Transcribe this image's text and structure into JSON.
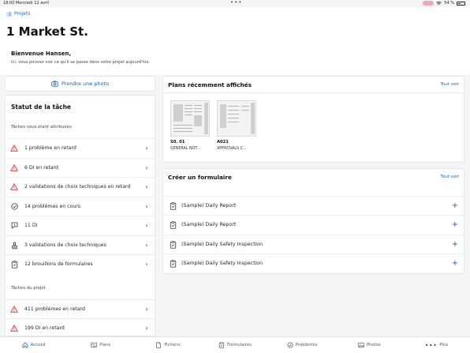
{
  "status_bar": {
    "time": "18:00",
    "date": "Mercredi 12 avril",
    "battery": "54 %"
  },
  "header": {
    "projects_link": "Projets",
    "title": "1 Market St.",
    "welcome": "Bienvenue Hansen,",
    "subtitle": "Ici, vous pouvez voir ce qu'il se passe dans votre projet aujourd'hui."
  },
  "photo_button": {
    "label": "Prendre une photo"
  },
  "task_status": {
    "title": "Statut de la tâche",
    "assigned_section": "Tâches vous étant attribuées",
    "assigned": [
      {
        "label": "1 problème en retard",
        "icon": "warning-icon"
      },
      {
        "label": "6 DI en retard",
        "icon": "warning-icon"
      },
      {
        "label": "2 validations de choix techniques en retard",
        "icon": "warning-icon"
      },
      {
        "label": "14 problèmes en cours",
        "icon": "issue-icon"
      },
      {
        "label": "11 DI",
        "icon": "rfi-icon"
      },
      {
        "label": "3 validations de choix techniques",
        "icon": "submittal-icon"
      },
      {
        "label": "12 brouillons de formulaires",
        "icon": "form-icon"
      }
    ],
    "project_section": "Tâches du projet",
    "project": [
      {
        "label": "411 problèmes en retard",
        "icon": "warning-icon"
      },
      {
        "label": "199 DI en retard",
        "icon": "warning-icon"
      }
    ]
  },
  "recent_plans": {
    "title": "Plans récemment affichés",
    "see_all": "Tout voir",
    "items": [
      {
        "number": "S0. 01",
        "name": "GENERAL NOT..."
      },
      {
        "number": "A021",
        "name": "APPROVALS C..."
      }
    ]
  },
  "create_form": {
    "title": "Créer un formulaire",
    "see_all": "Tout voir",
    "items": [
      {
        "label": "(Sample) Daily Report"
      },
      {
        "label": "(Sample) Daily Report"
      },
      {
        "label": "(Sample) Daily Safety Inspection"
      },
      {
        "label": "(Sample) Daily Safety Inspection"
      }
    ]
  },
  "tab_bar": [
    {
      "label": "Accueil",
      "icon": "home-icon",
      "active": true
    },
    {
      "label": "Plans",
      "icon": "plans-icon"
    },
    {
      "label": "Fichiers",
      "icon": "files-icon"
    },
    {
      "label": "Formulaires",
      "icon": "forms-icon"
    },
    {
      "label": "Problèmes",
      "icon": "issues-icon"
    },
    {
      "label": "Photos",
      "icon": "photos-icon"
    },
    {
      "label": "Plus",
      "icon": "more-icon"
    }
  ],
  "colors": {
    "accent": "#1f5fa8",
    "warning": "#d13b3b"
  }
}
